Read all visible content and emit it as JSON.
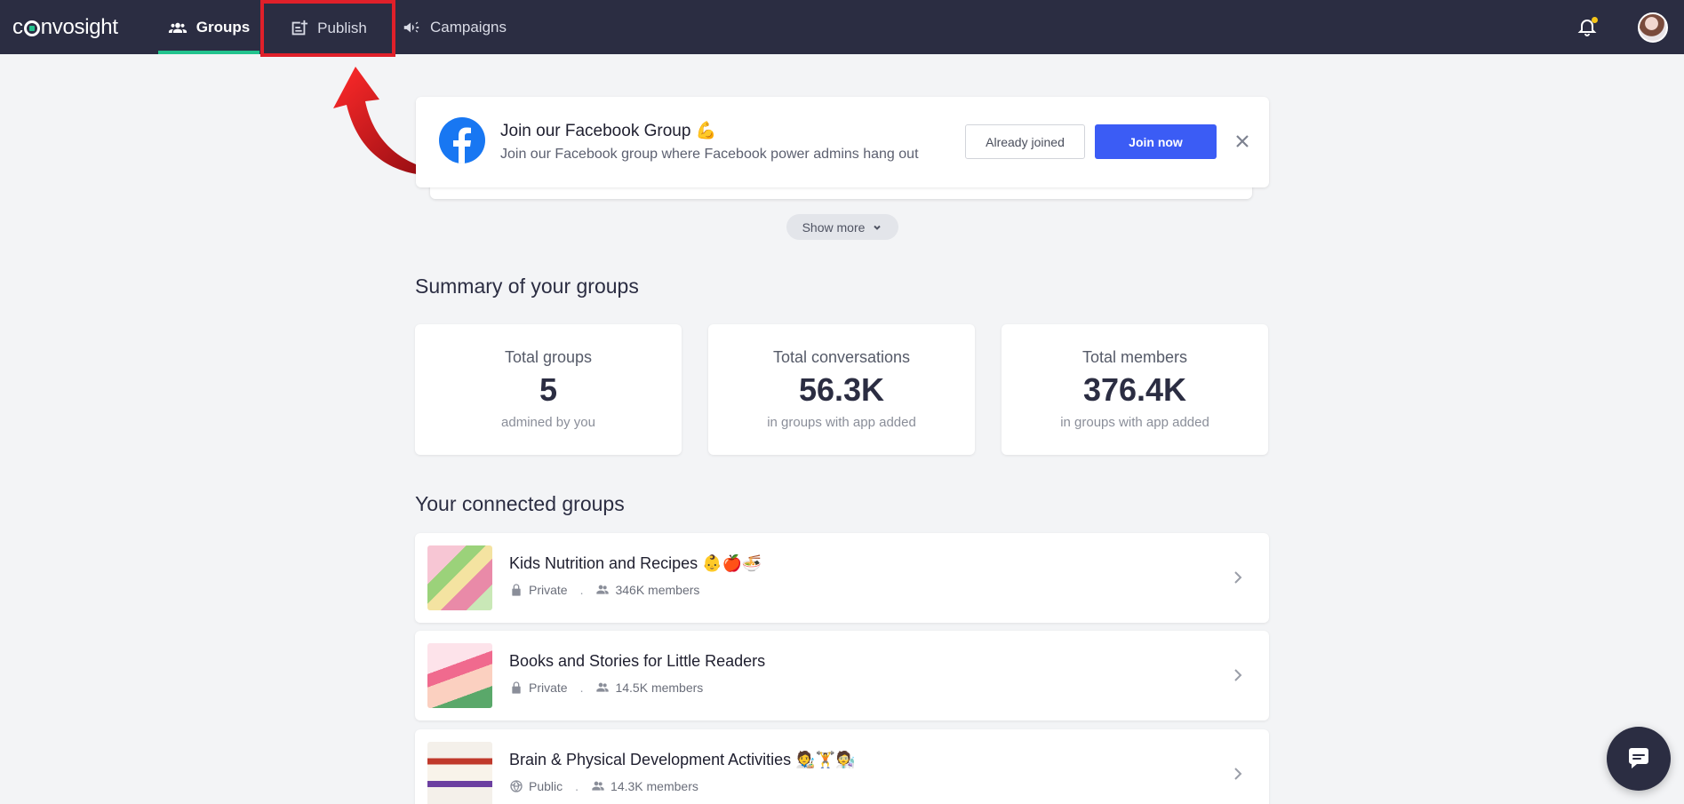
{
  "brand": {
    "name_pre": "c",
    "name_post": "nvosight"
  },
  "nav": {
    "groups": "Groups",
    "publish": "Publish",
    "campaigns": "Campaigns"
  },
  "promo": {
    "title": "Join our Facebook Group 💪",
    "subtitle": "Join our Facebook group where Facebook power admins hang out",
    "already_joined": "Already joined",
    "join_now": "Join now",
    "show_more": "Show more"
  },
  "summary": {
    "title": "Summary of your groups",
    "stats": [
      {
        "label": "Total groups",
        "value": "5",
        "note": "admined by you"
      },
      {
        "label": "Total conversations",
        "value": "56.3K",
        "note": "in groups with app added"
      },
      {
        "label": "Total members",
        "value": "376.4K",
        "note": "in groups with app added"
      }
    ]
  },
  "connected": {
    "title": "Your connected groups",
    "groups": [
      {
        "name": "Kids Nutrition and Recipes 👶🍎🍜",
        "privacy": "Private",
        "members": "346K members",
        "privacy_icon": "lock-icon"
      },
      {
        "name": "Books and Stories for Little Readers",
        "privacy": "Private",
        "members": "14.5K members",
        "privacy_icon": "lock-icon"
      },
      {
        "name": "Brain & Physical Development Activities 🧑‍🎨🏋️🧑‍🔬",
        "privacy": "Public",
        "members": "14.3K members",
        "privacy_icon": "globe-icon"
      }
    ]
  },
  "colors": {
    "nav_bg": "#2b2d42",
    "accent_green": "#22c38e",
    "primary_blue": "#3b5cf5",
    "highlight_red": "#e0202a"
  }
}
